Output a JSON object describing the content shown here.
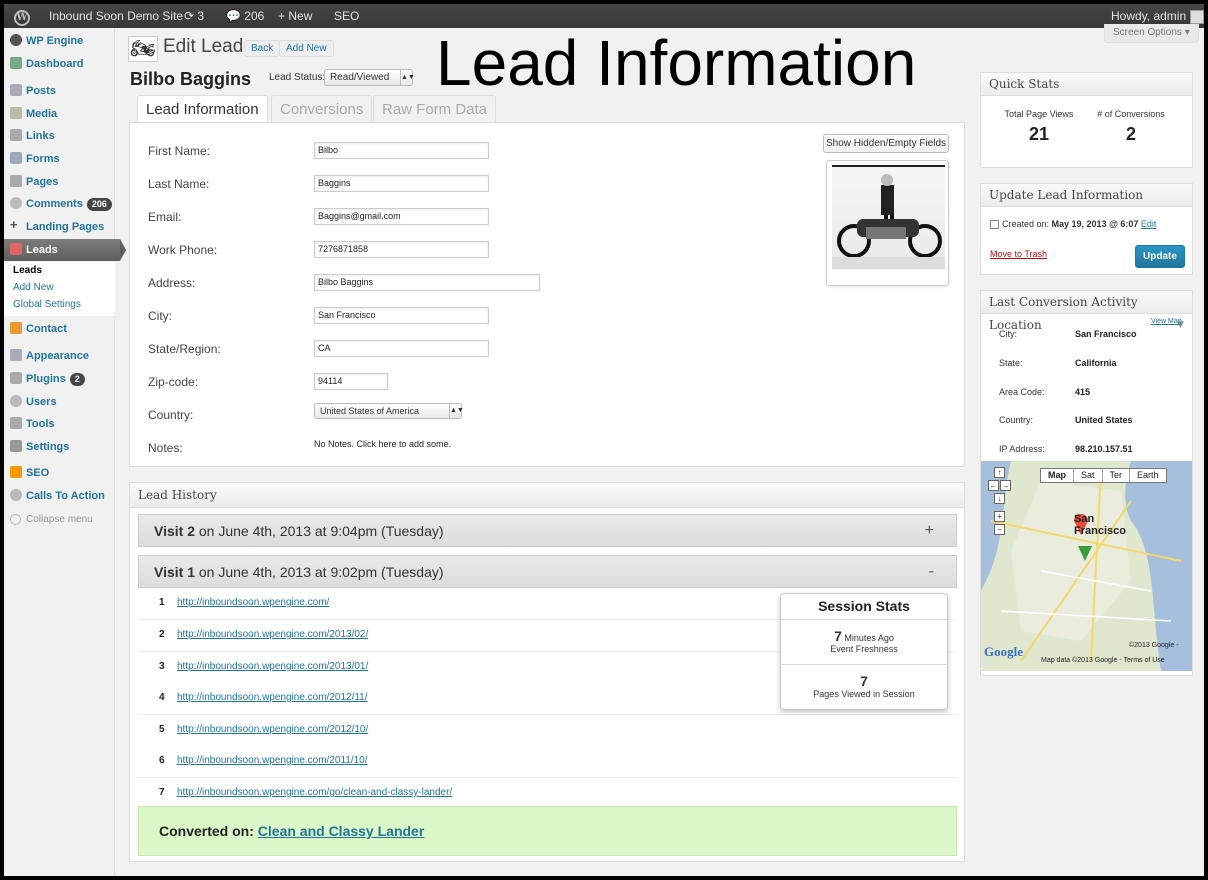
{
  "adminbar": {
    "site_name": "Inbound Soon Demo Site",
    "updates": "3",
    "comments": "206",
    "new_label": "New",
    "seo_label": "SEO",
    "greeting": "Howdy, admin"
  },
  "sidebar": {
    "items": [
      {
        "label": "WP Engine"
      },
      {
        "label": "Dashboard"
      },
      {
        "label": "Posts"
      },
      {
        "label": "Media"
      },
      {
        "label": "Links"
      },
      {
        "label": "Forms"
      },
      {
        "label": "Pages"
      },
      {
        "label": "Comments",
        "badge": "206"
      },
      {
        "label": "Landing Pages"
      },
      {
        "label": "Leads"
      },
      {
        "label": "Contact"
      },
      {
        "label": "Appearance"
      },
      {
        "label": "Plugins",
        "badge": "2"
      },
      {
        "label": "Users"
      },
      {
        "label": "Tools"
      },
      {
        "label": "Settings"
      },
      {
        "label": "SEO"
      },
      {
        "label": "Calls To Action"
      }
    ],
    "submenu": [
      "Leads",
      "Add New",
      "Global Settings"
    ],
    "collapse": "Collapse menu"
  },
  "header": {
    "title": "Edit Lead",
    "back": "Back",
    "add_new": "Add New",
    "overlay_title": "Lead Information",
    "screen_options": "Screen Options ▾",
    "lead_name": "Bilbo Baggins",
    "status_label": "Lead Status:",
    "status_value": "Read/Viewed"
  },
  "tabs": [
    "Lead Information",
    "Conversions",
    "Raw Form Data"
  ],
  "fields": {
    "first_name": {
      "label": "First Name:",
      "value": "Bilbo"
    },
    "last_name": {
      "label": "Last Name:",
      "value": "Baggins"
    },
    "email": {
      "label": "Email:",
      "value": "Baggins@gmail.com"
    },
    "phone": {
      "label": "Work Phone:",
      "value": "7276871858"
    },
    "address": {
      "label": "Address:",
      "value": "Bilbo Baggins"
    },
    "city": {
      "label": "City:",
      "value": "San Francisco"
    },
    "state": {
      "label": "State/Region:",
      "value": "CA"
    },
    "zip": {
      "label": "Zip-code:",
      "value": "94114"
    },
    "country": {
      "label": "Country:",
      "value": "United States of America"
    },
    "notes": {
      "label": "Notes:",
      "value": "No Notes. Click here to add some."
    }
  },
  "show_hidden": "Show Hidden/Empty Fields",
  "history": {
    "title": "Lead History",
    "visit2": {
      "name": "Visit 2",
      "when": " on June 4th, 2013 at 9:04pm (Tuesday)",
      "toggle": "+"
    },
    "visit1": {
      "name": "Visit 1",
      "when": " on June 4th, 2013 at 9:02pm (Tuesday)",
      "toggle": "-"
    },
    "urls": [
      {
        "n": "1",
        "url": "http://inboundsoon.wpengine.com/"
      },
      {
        "n": "2",
        "url": "http://inboundsoon.wpengine.com/2013/02/"
      },
      {
        "n": "3",
        "url": "http://inboundsoon.wpengine.com/2013/01/"
      },
      {
        "n": "4",
        "url": "http://inboundsoon.wpengine.com/2012/11/"
      },
      {
        "n": "5",
        "url": "http://inboundsoon.wpengine.com/2012/10/"
      },
      {
        "n": "6",
        "url": "http://inboundsoon.wpengine.com/2011/10/"
      },
      {
        "n": "7",
        "url": "http://inboundsoon.wpengine.com/go/clean-and-classy-lander/"
      }
    ],
    "converted_label": "Converted on: ",
    "converted_link": "Clean and Classy Lander"
  },
  "session": {
    "title": "Session Stats",
    "freshness_num": "7",
    "freshness_unit": " Minutes Ago",
    "freshness_label": "Event Freshness",
    "pages_num": "7",
    "pages_label": "Pages Viewed in Session"
  },
  "quick_stats": {
    "title": "Quick Stats",
    "views_label": "Total Page Views",
    "views": "21",
    "conv_label": "# of Conversions",
    "conversions": "2"
  },
  "update_box": {
    "title": "Update Lead Information",
    "created_label": "Created on: ",
    "created_value": "May 19, 2013 @ 6:07",
    "edit": "Edit",
    "trash": "Move to Trash",
    "update": "Update"
  },
  "location": {
    "title": "Last Conversion Activity Location",
    "view_map": "View Map",
    "rows": [
      {
        "k": "City:",
        "v": "San Francisco"
      },
      {
        "k": "State:",
        "v": "California"
      },
      {
        "k": "Area Code:",
        "v": "415"
      },
      {
        "k": "Country:",
        "v": "United States"
      },
      {
        "k": "IP Address:",
        "v": "98.210.157.51"
      }
    ],
    "map_tabs": [
      "Map",
      "Sat",
      "Ter",
      "Earth"
    ],
    "map_city": "San Francisco",
    "copyright": "©2013 Google -",
    "map_data": "Map data ©2013 Google - Terms of Use"
  },
  "colors": {
    "link": "#21759b",
    "converted_bg": "#dcf7c7",
    "update_btn": "#21759b"
  }
}
